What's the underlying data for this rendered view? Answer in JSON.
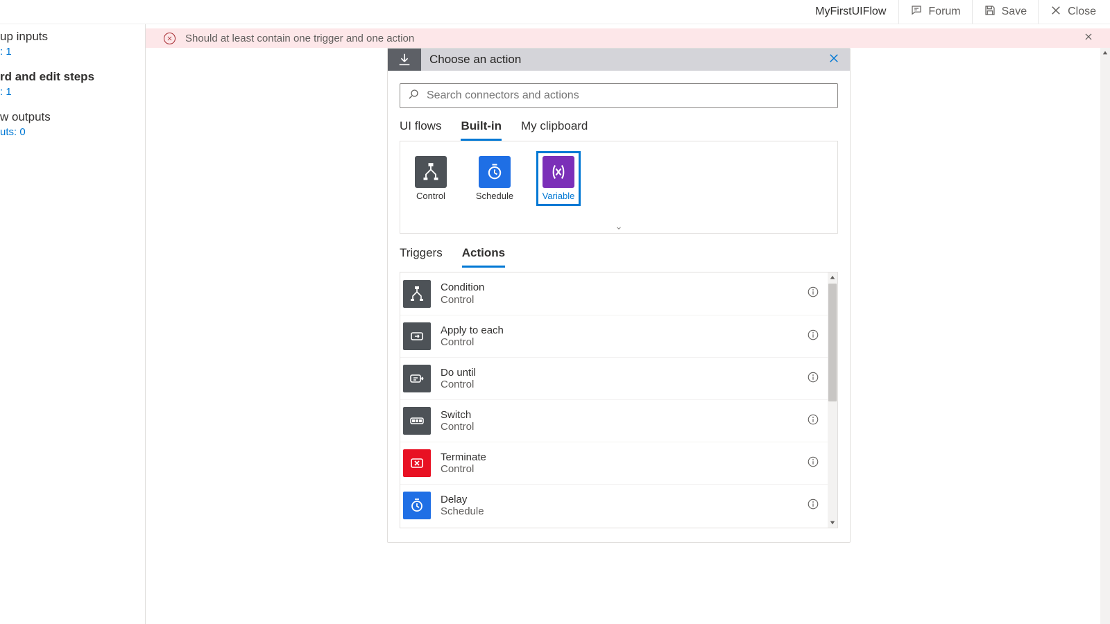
{
  "topbar": {
    "flow_name": "MyFirstUIFlow",
    "forum_label": "Forum",
    "save_label": "Save",
    "close_label": "Close"
  },
  "sidebar": {
    "inputs": {
      "title": "up inputs",
      "count": ": 1"
    },
    "steps": {
      "title": "rd and edit steps",
      "count": ": 1"
    },
    "outputs": {
      "title": "w outputs",
      "count": "uts: 0"
    }
  },
  "banner": {
    "message": "Should at least contain one trigger and one action"
  },
  "card": {
    "title": "Choose an action",
    "search_placeholder": "Search connectors and actions",
    "conn_tabs": {
      "uiflows": "UI flows",
      "builtin": "Built-in",
      "clipboard": "My clipboard"
    },
    "tiles": {
      "control": {
        "label": "Control",
        "bg": "#4d5257"
      },
      "schedule": {
        "label": "Schedule",
        "bg": "#1f6fe5"
      },
      "variable": {
        "label": "Variable",
        "bg": "#7b2fb8"
      }
    },
    "tr_tabs": {
      "triggers": "Triggers",
      "actions": "Actions"
    },
    "actions": [
      {
        "name": "Condition",
        "group": "Control",
        "bg": "#4d5257",
        "icon": "branch"
      },
      {
        "name": "Apply to each",
        "group": "Control",
        "bg": "#4d5257",
        "icon": "loop"
      },
      {
        "name": "Do until",
        "group": "Control",
        "bg": "#4d5257",
        "icon": "until"
      },
      {
        "name": "Switch",
        "group": "Control",
        "bg": "#4d5257",
        "icon": "switch"
      },
      {
        "name": "Terminate",
        "group": "Control",
        "bg": "#e81123",
        "icon": "terminate"
      },
      {
        "name": "Delay",
        "group": "Schedule",
        "bg": "#1f6fe5",
        "icon": "clock"
      }
    ]
  }
}
